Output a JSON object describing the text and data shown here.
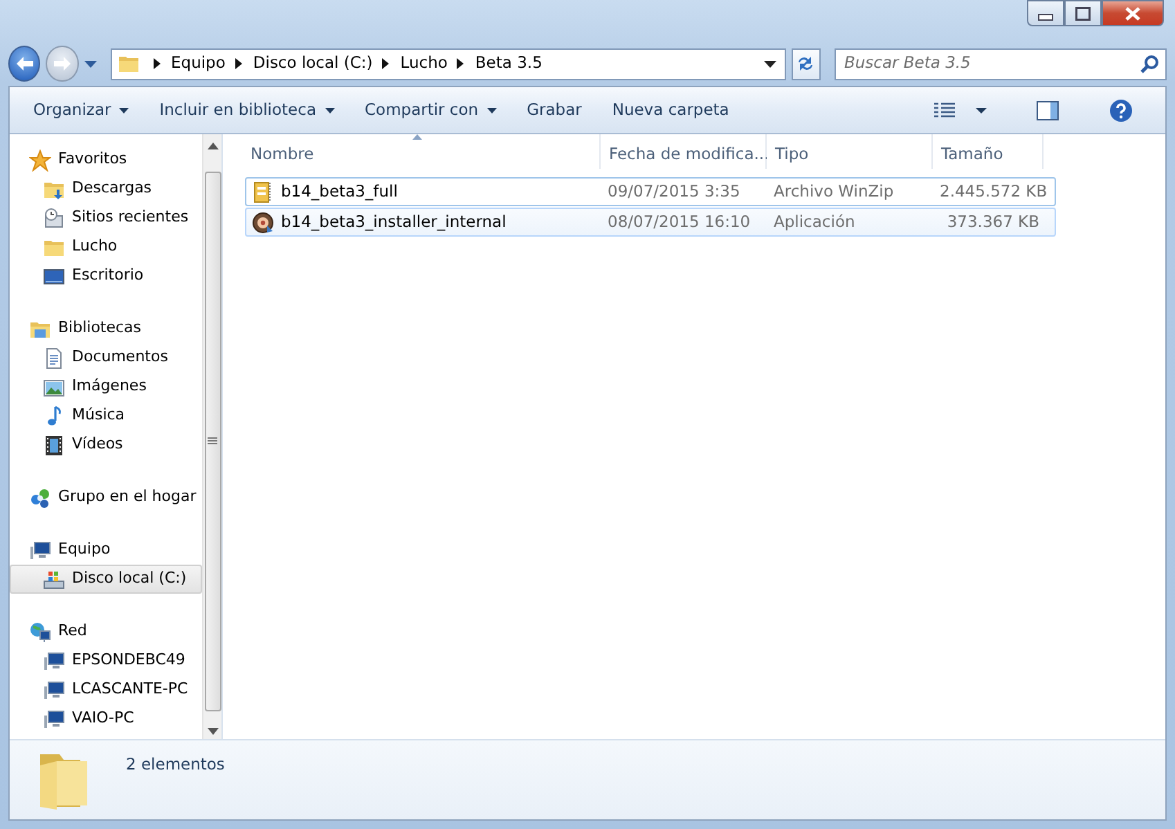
{
  "address_bar": {
    "path": [
      "Equipo",
      "Disco local (C:)",
      "Lucho",
      "Beta 3.5"
    ]
  },
  "search": {
    "placeholder": "Buscar Beta 3.5"
  },
  "toolbar": {
    "items": [
      {
        "label": "Organizar",
        "dropdown": true
      },
      {
        "label": "Incluir en biblioteca",
        "dropdown": true
      },
      {
        "label": "Compartir con",
        "dropdown": true
      },
      {
        "label": "Grabar",
        "dropdown": false
      },
      {
        "label": "Nueva carpeta",
        "dropdown": false
      }
    ]
  },
  "navigation": [
    {
      "label": "Favoritos",
      "kind": "star",
      "selected": false,
      "children": [
        {
          "label": "Descargas",
          "kind": "downloads",
          "selected": false
        },
        {
          "label": "Sitios recientes",
          "kind": "recent",
          "selected": false
        },
        {
          "label": "Lucho",
          "kind": "folder",
          "selected": false
        },
        {
          "label": "Escritorio",
          "kind": "desktop",
          "selected": false
        }
      ]
    },
    {
      "label": "Bibliotecas",
      "kind": "libraries",
      "selected": false,
      "children": [
        {
          "label": "Documentos",
          "kind": "document",
          "selected": false
        },
        {
          "label": "Imágenes",
          "kind": "pictures",
          "selected": false
        },
        {
          "label": "Música",
          "kind": "music",
          "selected": false
        },
        {
          "label": "Vídeos",
          "kind": "videos",
          "selected": false
        }
      ]
    },
    {
      "label": "Grupo en el hogar",
      "kind": "homegroup",
      "selected": false
    },
    {
      "label": "Equipo",
      "kind": "computer",
      "selected": false,
      "children": [
        {
          "label": "Disco local (C:)",
          "kind": "drive",
          "selected": true
        }
      ]
    },
    {
      "label": "Red",
      "kind": "network",
      "selected": false,
      "children": [
        {
          "label": "EPSONDEBC49",
          "kind": "computer",
          "selected": false
        },
        {
          "label": "LCASCANTE-PC",
          "kind": "computer",
          "selected": false
        },
        {
          "label": "VAIO-PC",
          "kind": "computer",
          "selected": false
        }
      ]
    }
  ],
  "file_list": {
    "columns": [
      {
        "label": "Nombre",
        "sorted": true
      },
      {
        "label": "Fecha de modifica...",
        "sorted": false
      },
      {
        "label": "Tipo",
        "sorted": false
      },
      {
        "label": "Tamaño",
        "sorted": false
      }
    ],
    "rows": [
      {
        "kind": "zip",
        "focused": true,
        "hot": false,
        "cells": [
          "b14_beta3_full",
          "09/07/2015 3:35",
          "Archivo WinZip",
          "2.445.572 KB"
        ]
      },
      {
        "kind": "app",
        "focused": false,
        "hot": true,
        "cells": [
          "b14_beta3_installer_internal",
          "08/07/2015 16:10",
          "Aplicación",
          "373.367 KB"
        ]
      }
    ]
  },
  "status_bar": {
    "text": "2 elementos"
  }
}
